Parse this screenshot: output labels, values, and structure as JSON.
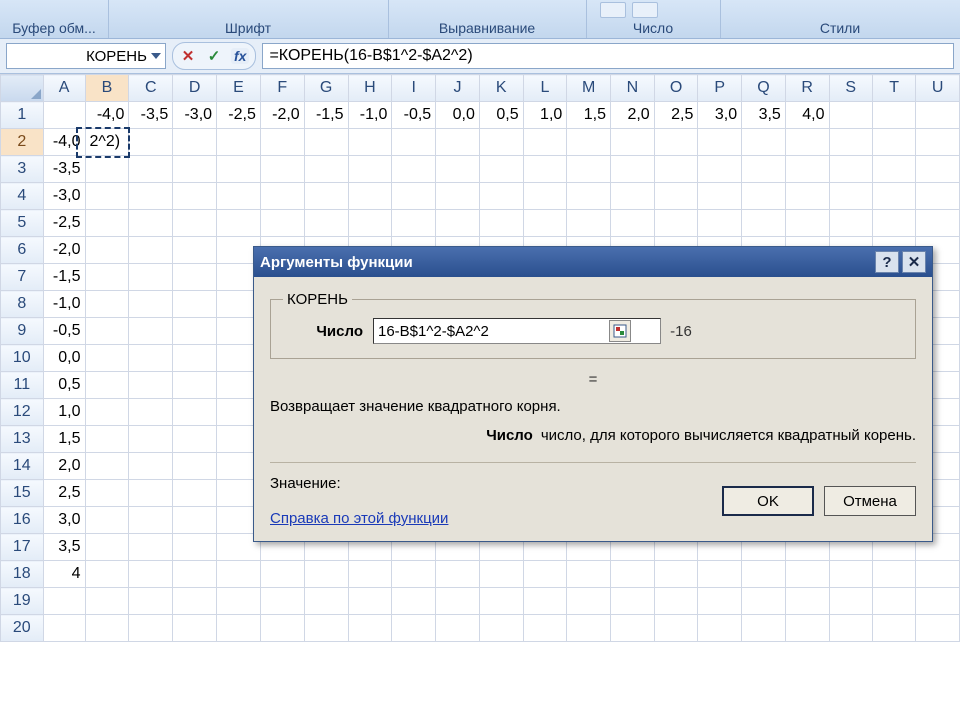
{
  "ribbon": {
    "groups": {
      "clipboard": "Буфер обм...",
      "font": "Шрифт",
      "alignment": "Выравнивание",
      "number": "Число",
      "styles": "Стили"
    }
  },
  "formula_bar": {
    "name_box": "КОРЕНЬ",
    "fx_label": "fx",
    "formula": "=КОРЕНЬ(16-B$1^2-$A2^2)"
  },
  "columns": [
    "A",
    "B",
    "C",
    "D",
    "E",
    "F",
    "G",
    "H",
    "I",
    "J",
    "K",
    "L",
    "M",
    "N",
    "O",
    "P",
    "Q",
    "R",
    "S",
    "T",
    "U"
  ],
  "row1": [
    "",
    "-4,0",
    "-3,5",
    "-3,0",
    "-2,5",
    "-2,0",
    "-1,5",
    "-1,0",
    "-0,5",
    "0,0",
    "0,5",
    "1,0",
    "1,5",
    "2,0",
    "2,5",
    "3,0",
    "3,5",
    "4,0",
    "",
    "",
    ""
  ],
  "colA_rows": [
    "-4,0",
    "-3,5",
    "-3,0",
    "-2,5",
    "-2,0",
    "-1,5",
    "-1,0",
    "-0,5",
    "0,0",
    "0,5",
    "1,0",
    "1,5",
    "2,0",
    "2,5",
    "3,0",
    "3,5",
    "4"
  ],
  "b2_display": "2^2)",
  "dialog": {
    "title": "Аргументы функции",
    "fn_name": "КОРЕНЬ",
    "arg_label": "Число",
    "arg_value": "16-B$1^2-$A2^2",
    "arg_result": "-16",
    "result_eq": "=",
    "description": "Возвращает значение квадратного корня.",
    "arg_name": "Число",
    "arg_desc": "число, для которого вычисляется квадратный корень.",
    "value_label": "Значение:",
    "help_link": "Справка по этой функции",
    "ok": "OK",
    "cancel": "Отмена",
    "help_icon": "?",
    "close_icon": "✕",
    "eq_sym": "="
  }
}
